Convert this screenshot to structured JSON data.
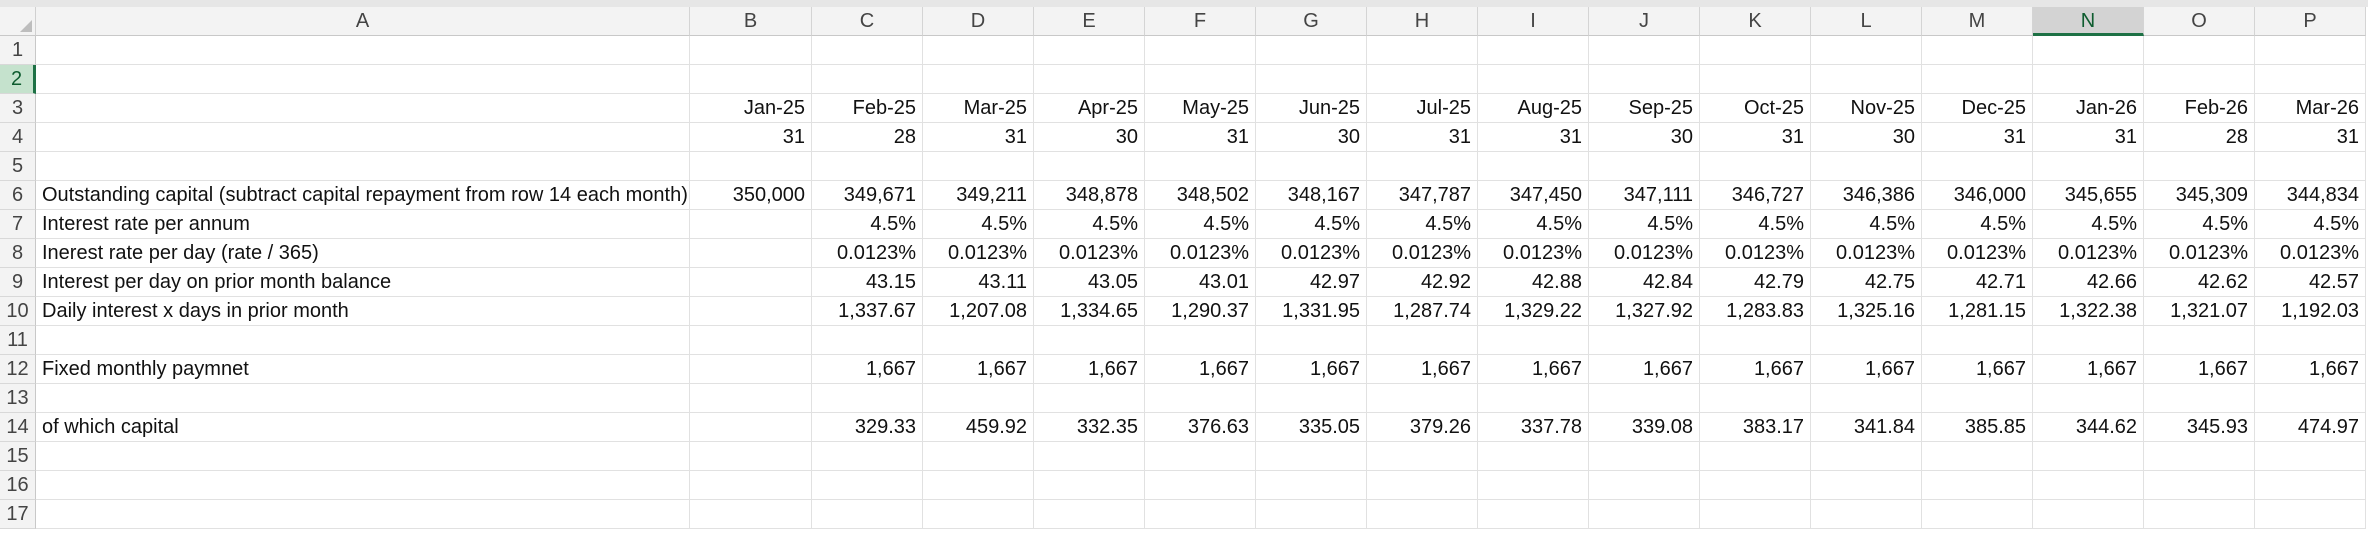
{
  "columns": [
    "A",
    "B",
    "C",
    "D",
    "E",
    "F",
    "G",
    "H",
    "I",
    "J",
    "K",
    "L",
    "M",
    "N",
    "O",
    "P"
  ],
  "selected_column": "N",
  "rows": [
    "1",
    "2",
    "3",
    "4",
    "5",
    "6",
    "7",
    "8",
    "9",
    "10",
    "11",
    "12",
    "13",
    "14",
    "15",
    "16",
    "17"
  ],
  "selected_row": "2",
  "cells": {
    "3": {
      "B": "Jan-25",
      "C": "Feb-25",
      "D": "Mar-25",
      "E": "Apr-25",
      "F": "May-25",
      "G": "Jun-25",
      "H": "Jul-25",
      "I": "Aug-25",
      "J": "Sep-25",
      "K": "Oct-25",
      "L": "Nov-25",
      "M": "Dec-25",
      "N": "Jan-26",
      "O": "Feb-26",
      "P": "Mar-26"
    },
    "4": {
      "B": "31",
      "C": "28",
      "D": "31",
      "E": "30",
      "F": "31",
      "G": "30",
      "H": "31",
      "I": "31",
      "J": "30",
      "K": "31",
      "L": "30",
      "M": "31",
      "N": "31",
      "O": "28",
      "P": "31"
    },
    "6": {
      "A": "Outstanding capital (subtract capital repayment from row 14 each month)",
      "B": "350,000",
      "C": "349,671",
      "D": "349,211",
      "E": "348,878",
      "F": "348,502",
      "G": "348,167",
      "H": "347,787",
      "I": "347,450",
      "J": "347,111",
      "K": "346,727",
      "L": "346,386",
      "M": "346,000",
      "N": "345,655",
      "O": "345,309",
      "P": "344,834"
    },
    "7": {
      "A": "Interest rate per annum",
      "C": "4.5%",
      "D": "4.5%",
      "E": "4.5%",
      "F": "4.5%",
      "G": "4.5%",
      "H": "4.5%",
      "I": "4.5%",
      "J": "4.5%",
      "K": "4.5%",
      "L": "4.5%",
      "M": "4.5%",
      "N": "4.5%",
      "O": "4.5%",
      "P": "4.5%"
    },
    "8": {
      "A": "Inerest rate per day (rate / 365)",
      "C": "0.0123%",
      "D": "0.0123%",
      "E": "0.0123%",
      "F": "0.0123%",
      "G": "0.0123%",
      "H": "0.0123%",
      "I": "0.0123%",
      "J": "0.0123%",
      "K": "0.0123%",
      "L": "0.0123%",
      "M": "0.0123%",
      "N": "0.0123%",
      "O": "0.0123%",
      "P": "0.0123%"
    },
    "9": {
      "A": " Interest per day on prior month balance",
      "C": "43.15",
      "D": "43.11",
      "E": "43.05",
      "F": "43.01",
      "G": "42.97",
      "H": "42.92",
      "I": "42.88",
      "J": "42.84",
      "K": "42.79",
      "L": "42.75",
      "M": "42.71",
      "N": "42.66",
      "O": "42.62",
      "P": "42.57"
    },
    "10": {
      "A": " Daily interest x days in prior month",
      "C": "1,337.67",
      "D": "1,207.08",
      "E": "1,334.65",
      "F": "1,290.37",
      "G": "1,331.95",
      "H": "1,287.74",
      "I": "1,329.22",
      "J": "1,327.92",
      "K": "1,283.83",
      "L": "1,325.16",
      "M": "1,281.15",
      "N": "1,322.38",
      "O": "1,321.07",
      "P": "1,192.03"
    },
    "12": {
      "A": " Fixed monthly paymnet",
      "C": "1,667",
      "D": "1,667",
      "E": "1,667",
      "F": "1,667",
      "G": "1,667",
      "H": "1,667",
      "I": "1,667",
      "J": "1,667",
      "K": "1,667",
      "L": "1,667",
      "M": "1,667",
      "N": "1,667",
      "O": "1,667",
      "P": "1,667"
    },
    "14": {
      "A": " of which capital",
      "C": "329.33",
      "D": "459.92",
      "E": "332.35",
      "F": "376.63",
      "G": "335.05",
      "H": "379.26",
      "I": "337.78",
      "J": "339.08",
      "K": "383.17",
      "L": "341.84",
      "M": "385.85",
      "N": "344.62",
      "O": "345.93",
      "P": "474.97"
    }
  },
  "colors": {
    "selection_green": "#1e7145",
    "header_bg": "#f3f3f3",
    "gridline": "#e1e1e1"
  }
}
